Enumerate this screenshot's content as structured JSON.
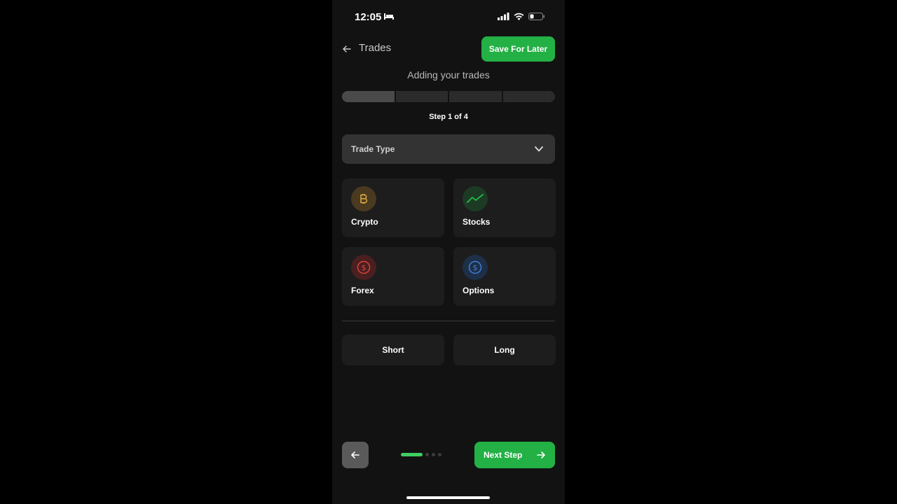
{
  "status": {
    "time": "12:05"
  },
  "header": {
    "title": "Trades",
    "save_label": "Save For Later"
  },
  "subtitle": "Adding your trades",
  "progress": {
    "current_step": 1,
    "total_steps": 4,
    "label": "Step 1 of 4"
  },
  "dropdown": {
    "label": "Trade Type"
  },
  "trade_types": [
    {
      "label": "Crypto",
      "icon": "bitcoin-icon",
      "color": "#d9a441"
    },
    {
      "label": "Stocks",
      "icon": "trending-up-icon",
      "color": "#23b045"
    },
    {
      "label": "Forex",
      "icon": "dollar-circle-icon",
      "color": "#d9443c"
    },
    {
      "label": "Options",
      "icon": "dollar-circle-icon",
      "color": "#3f7fd6"
    }
  ],
  "direction": {
    "short_label": "Short",
    "long_label": "Long"
  },
  "footer": {
    "next_label": "Next Step",
    "page_dots": 4,
    "active_dot": 1
  },
  "colors": {
    "accent": "#23b045",
    "background": "#121212",
    "card": "#1d1d1d"
  }
}
